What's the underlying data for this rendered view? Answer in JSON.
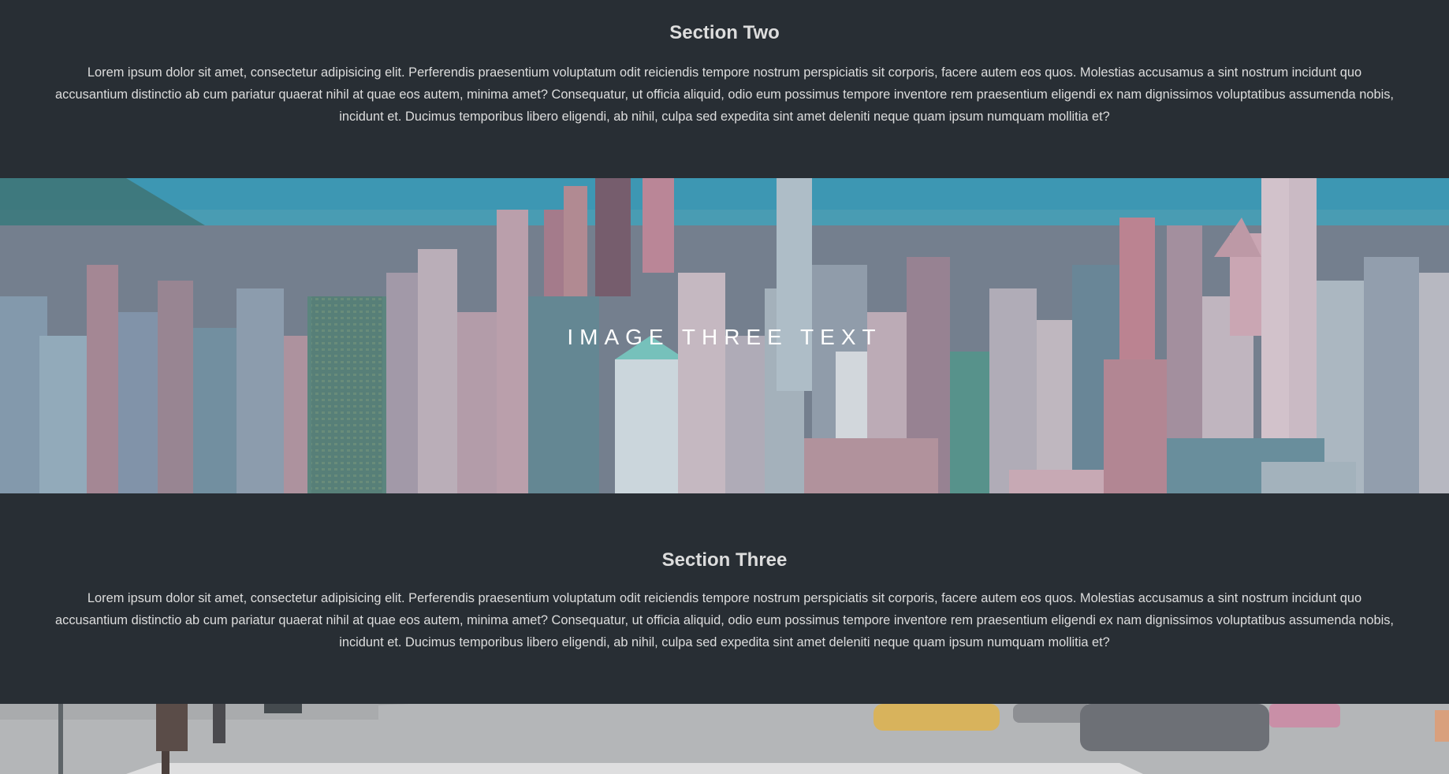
{
  "sections": {
    "two": {
      "title": "Section Two",
      "body": "Lorem ipsum dolor sit amet, consectetur adipisicing elit. Perferendis praesentium voluptatum odit reiciendis tempore nostrum perspiciatis sit corporis, facere autem eos quos. Molestias accusamus a sint nostrum incidunt quo accusantium distinctio ab cum pariatur quaerat nihil at quae eos autem, minima amet? Consequatur, ut officia aliquid, odio eum possimus tempore inventore rem praesentium eligendi ex nam dignissimos voluptatibus assumenda nobis, incidunt et. Ducimus temporibus libero eligendi, ab nihil, culpa sed expedita sint amet deleniti neque quam ipsum numquam mollitia et?"
    },
    "three": {
      "title": "Section Three",
      "body": "Lorem ipsum dolor sit amet, consectetur adipisicing elit. Perferendis praesentium voluptatum odit reiciendis tempore nostrum perspiciatis sit corporis, facere autem eos quos. Molestias accusamus a sint nostrum incidunt quo accusantium distinctio ab cum pariatur quaerat nihil at quae eos autem, minima amet? Consequatur, ut officia aliquid, odio eum possimus tempore inventore rem praesentium eligendi ex nam dignissimos voluptatibus assumenda nobis, incidunt et. Ducimus temporibus libero eligendi, ab nihil, culpa sed expedita sint amet deleniti neque quam ipsum numquam mollitia et?"
    }
  },
  "banner": {
    "caption": "IMAGE THREE TEXT"
  },
  "colors": {
    "section_bg": "#282e34",
    "text": "#dddddd",
    "caption": "#ffffff"
  }
}
